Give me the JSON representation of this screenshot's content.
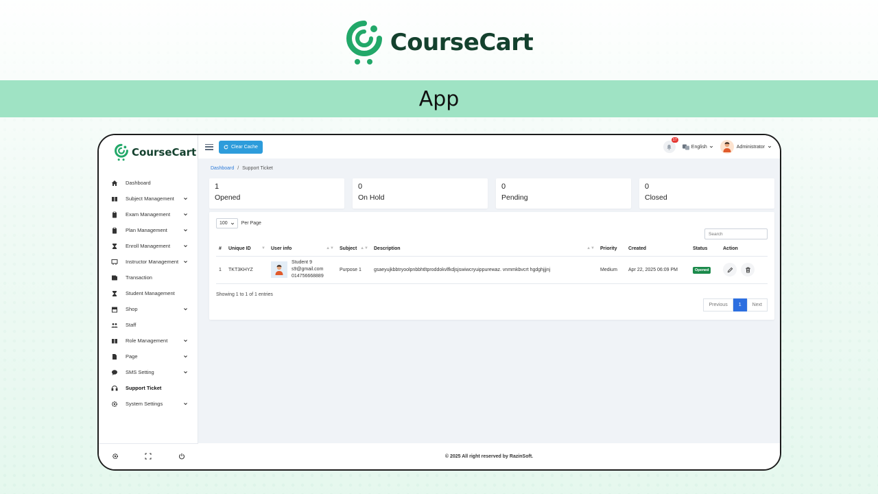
{
  "brand": {
    "name": "CourseCart",
    "accent": "#22a869",
    "dark": "#14412e"
  },
  "banner": {
    "title": "App",
    "color": "#9fe3c4"
  },
  "sidebar": {
    "logo": "CourseCart",
    "items": [
      {
        "label": "Dashboard",
        "icon": "home-icon",
        "has_chevron": false
      },
      {
        "label": "Subject Management",
        "icon": "book-icon",
        "has_chevron": true
      },
      {
        "label": "Exam Management",
        "icon": "clipboard-icon",
        "has_chevron": true
      },
      {
        "label": "Plan Management",
        "icon": "clipboard-icon",
        "has_chevron": true
      },
      {
        "label": "Enroll Management",
        "icon": "hourglass-icon",
        "has_chevron": true
      },
      {
        "label": "Instructor Management",
        "icon": "chalkboard-icon",
        "has_chevron": true
      },
      {
        "label": "Transaction",
        "icon": "wallet-icon",
        "has_chevron": false
      },
      {
        "label": "Student Management",
        "icon": "hourglass-icon",
        "has_chevron": false
      },
      {
        "label": "Shop",
        "icon": "store-icon",
        "has_chevron": true
      },
      {
        "label": "Staff",
        "icon": "users-icon",
        "has_chevron": false
      },
      {
        "label": "Role Management",
        "icon": "book-icon",
        "has_chevron": true
      },
      {
        "label": "Page",
        "icon": "file-icon",
        "has_chevron": true
      },
      {
        "label": "SMS Setting",
        "icon": "chat-icon",
        "has_chevron": true
      },
      {
        "label": "Support Ticket",
        "icon": "headset-icon",
        "has_chevron": false,
        "active": true
      },
      {
        "label": "System Settings",
        "icon": "gear-icon",
        "has_chevron": true
      }
    ]
  },
  "topbar": {
    "clear_cache": "Clear Cache",
    "notifications": "17",
    "language": "English",
    "user": "Administrator",
    "button_color": "#2d9cdb"
  },
  "breadcrumb": {
    "home": "Dashboard",
    "separator": "/",
    "current": "Support Ticket"
  },
  "stats": [
    {
      "value": "1",
      "label": "Opened"
    },
    {
      "value": "0",
      "label": "On Hold"
    },
    {
      "value": "0",
      "label": "Pending"
    },
    {
      "value": "0",
      "label": "Closed"
    }
  ],
  "table": {
    "per_page_value": "100",
    "per_page_label": "Per Page",
    "search_placeholder": "Search",
    "columns": [
      "#",
      "Unique ID",
      "User info",
      "Subject",
      "Description",
      "Priority",
      "Created",
      "Status",
      "Action"
    ],
    "rows": [
      {
        "num": "1",
        "unique_id": "TKT3KHYZ",
        "user_name": "Student 9",
        "user_email": "s9@gmail.com",
        "user_phone": "014756668889",
        "subject": "Purpose 1",
        "description": "gsaeyujkbbtryoolpnbbhtltproddokvlfkdjsjswiwcryuippurewaz. vnmmkbvcrt hgdghjjjnj",
        "priority": "Medium",
        "created": "Apr 22, 2025 06:09 PM",
        "status": "Opened",
        "status_color": "#1b8a4b"
      }
    ],
    "showing": "Showing 1 to 1 of 1 entries",
    "pagination": {
      "previous": "Previous",
      "current": "1",
      "next": "Next"
    }
  },
  "footer": {
    "text": "© 2025 All right reserved by RazinSoft."
  }
}
